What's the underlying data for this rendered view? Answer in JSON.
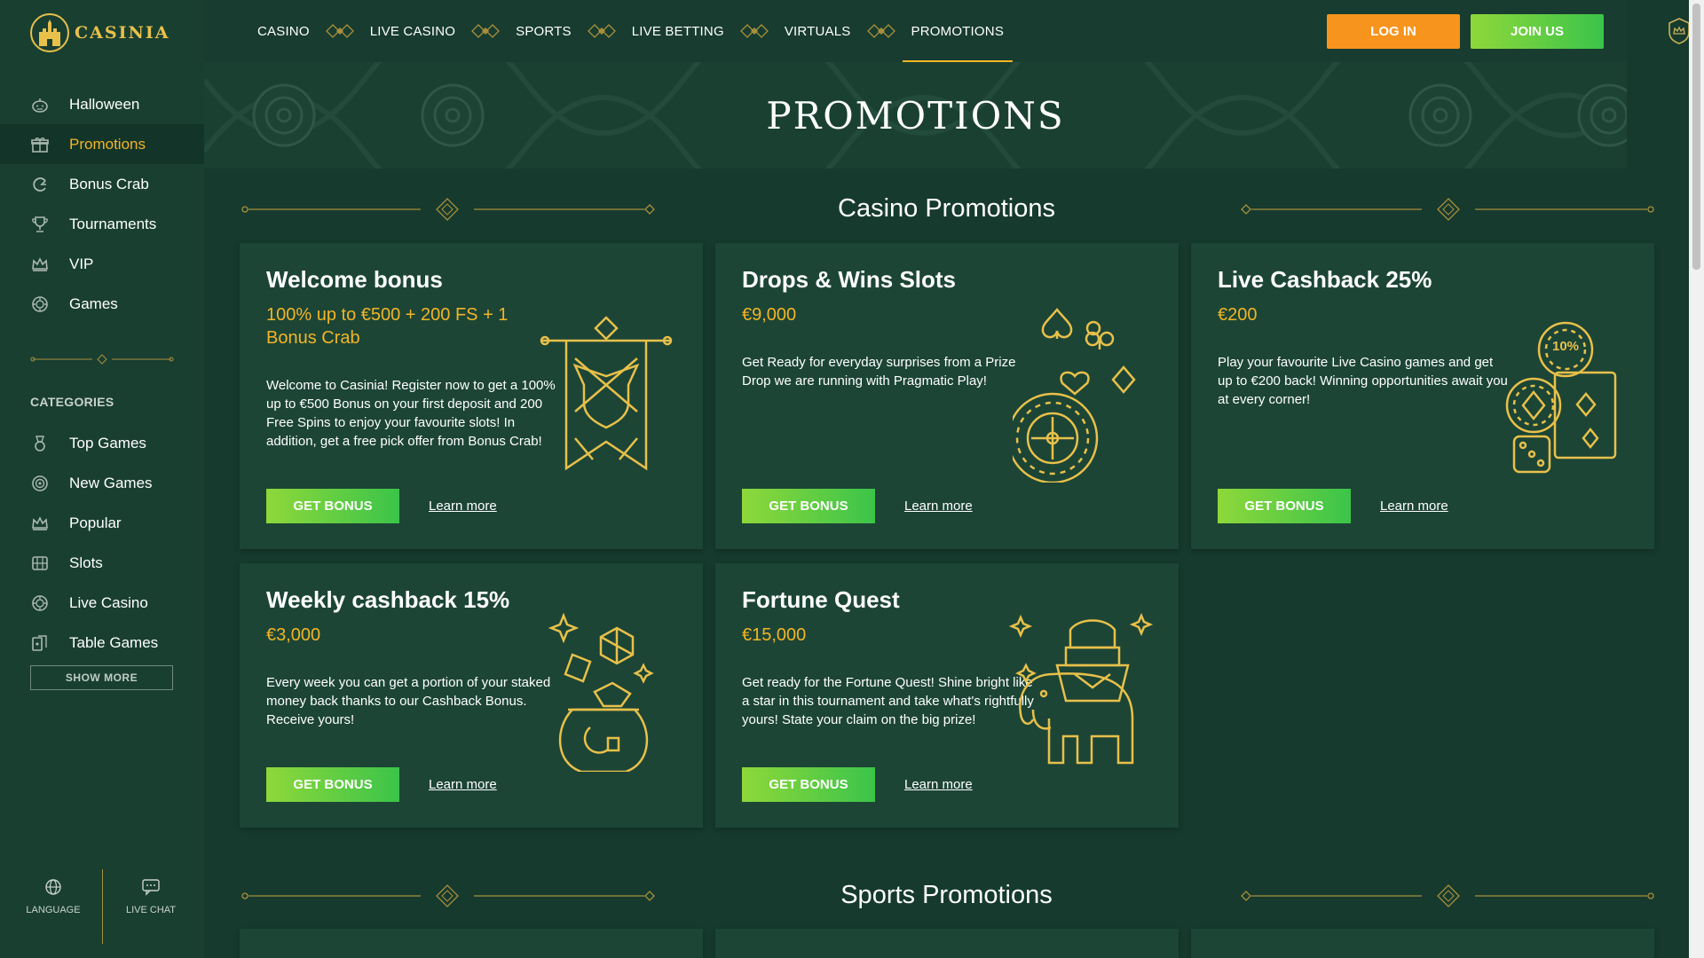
{
  "brand": {
    "name": "CASINIA"
  },
  "sidebar": {
    "items": [
      {
        "label": "Halloween",
        "icon": "pumpkin-icon"
      },
      {
        "label": "Promotions",
        "icon": "gift-icon",
        "active": true
      },
      {
        "label": "Bonus Crab",
        "icon": "crab-icon"
      },
      {
        "label": "Tournaments",
        "icon": "trophy-icon"
      },
      {
        "label": "VIP",
        "icon": "crown-icon"
      },
      {
        "label": "Games",
        "icon": "chip-icon"
      }
    ],
    "categories_title": "CATEGORIES",
    "categories": [
      {
        "label": "Top Games",
        "icon": "medal-icon"
      },
      {
        "label": "New Games",
        "icon": "target-icon"
      },
      {
        "label": "Popular",
        "icon": "crown-icon"
      },
      {
        "label": "Slots",
        "icon": "slot-icon"
      },
      {
        "label": "Live Casino",
        "icon": "chip-icon"
      },
      {
        "label": "Table Games",
        "icon": "cards-icon"
      }
    ],
    "show_more": "SHOW MORE",
    "language": "LANGUAGE",
    "live_chat": "LIVE CHAT"
  },
  "topnav": {
    "items": [
      "CASINO",
      "LIVE CASINO",
      "SPORTS",
      "LIVE BETTING",
      "VIRTUALS",
      "PROMOTIONS"
    ],
    "active": "PROMOTIONS",
    "login": "LOG IN",
    "join": "JOIN US"
  },
  "hero": {
    "title": "PROMOTIONS"
  },
  "casino_section": {
    "title": "Casino Promotions"
  },
  "sports_section": {
    "title": "Sports Promotions"
  },
  "cards": [
    {
      "title": "Welcome bonus",
      "amount": "100% up to €500 + 200 FS + 1 Bonus Crab",
      "desc": "Welcome to Casinia! Register now to get a 100% up to €500 Bonus on your first deposit and 200 Free Spins to enjoy your favourite slots! In addition, get a free pick offer from Bonus Crab!",
      "button": "GET BONUS",
      "link": "Learn more"
    },
    {
      "title": "Drops & Wins Slots",
      "amount": "€9,000",
      "desc": "Get Ready for everyday surprises from a Prize Drop we are running with Pragmatic Play!",
      "button": "GET BONUS",
      "link": "Learn more"
    },
    {
      "title": "Live Cashback 25%",
      "amount": "€200",
      "desc": "Play your favourite Live Casino games and get up to €200 back! Winning opportunities await you at every corner!",
      "button": "GET BONUS",
      "link": "Learn more",
      "chip_label": "10%"
    },
    {
      "title": "Weekly cashback 15%",
      "amount": "€3,000",
      "desc": "Every week you can get a portion of your staked money back thanks to our Cashback Bonus. Receive yours!",
      "button": "GET BONUS",
      "link": "Learn more"
    },
    {
      "title": "Fortune Quest",
      "amount": "€15,000",
      "desc": "Get ready for the Fortune Quest! Shine bright like a star in this tournament and take what's rightfully yours! State your claim on the big prize!",
      "button": "GET BONUS",
      "link": "Learn more"
    }
  ],
  "colors": {
    "accent": "#f2b526",
    "green": "#4ac84a",
    "orange": "#f7941d",
    "bg": "#163a2e"
  }
}
